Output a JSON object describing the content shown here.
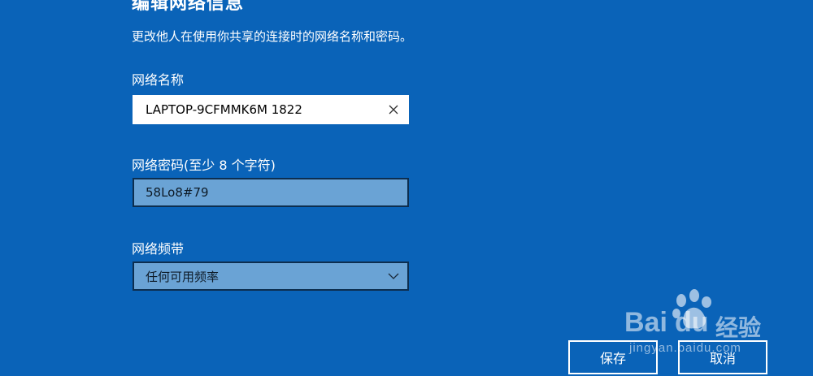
{
  "dialog": {
    "title": "编辑网络信息",
    "description": "更改他人在使用你共享的连接时的网络名称和密码。"
  },
  "network_name": {
    "label": "网络名称",
    "value": "LAPTOP-9CFMMK6M 1822"
  },
  "password": {
    "label": "网络密码(至少 8 个字符)",
    "value": "58Lo8#79"
  },
  "band": {
    "label": "网络频带",
    "selected": "任何可用频率"
  },
  "buttons": {
    "save": "保存",
    "cancel": "取消"
  },
  "watermark": {
    "brand_a": "Bai",
    "brand_b": "du",
    "brand_c": "经验",
    "url": "jingyan.baidu.com"
  },
  "colors": {
    "background": "#0a63b8",
    "field_dim": "#6aa3d5"
  }
}
